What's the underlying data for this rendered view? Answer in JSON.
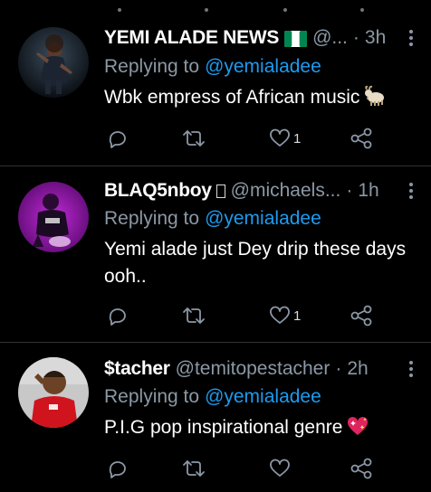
{
  "colors": {
    "background": "#000000",
    "secondary_text": "#8b98a5",
    "link": "#1d9bf0",
    "divider": "#2f3336"
  },
  "tweets": [
    {
      "display_name": "YEMI ALADE NEWS",
      "badge_icon": "nigeria-flag-icon",
      "handle": "@...",
      "separator": "·",
      "time": "3h",
      "reply_prefix": "Replying to",
      "reply_to": "@yemialadee",
      "text": "Wbk empress of African music",
      "emoji_icon": "goat-emoji-icon",
      "likes": "1"
    },
    {
      "display_name": "BLAQ5nboy",
      "badge_icon": "unsupported-glyph-icon",
      "handle": "@michaels...",
      "separator": "·",
      "time": "1h",
      "reply_prefix": "Replying to",
      "reply_to": "@yemialadee",
      "text": "Yemi alade just Dey drip these days ooh..",
      "likes": "1"
    },
    {
      "display_name": "$tacher",
      "handle": "@temitopestacher",
      "separator": "·",
      "time": "2h",
      "reply_prefix": "Replying to",
      "reply_to": "@yemialadee",
      "text": "P.I.G pop inspirational genre",
      "emoji_icon": "sparkling-heart-emoji-icon",
      "likes": ""
    }
  ]
}
